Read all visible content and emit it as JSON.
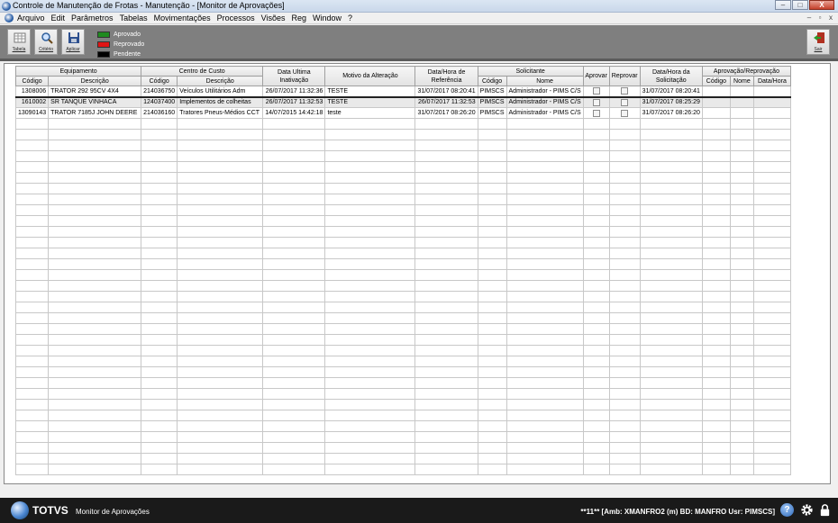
{
  "window": {
    "title": "Controle de Manutenção de Frotas - Manutenção - [Monitor de Aprovações]",
    "buttons": [
      "–",
      "□",
      "X"
    ]
  },
  "menubar": {
    "items": [
      "Arquivo",
      "Edit",
      "Parâmetros",
      "Tabelas",
      "Movimentações",
      "Processos",
      "Visões",
      "Reg",
      "Window",
      "?"
    ],
    "mdi_buttons": [
      "–",
      "▫",
      "x"
    ]
  },
  "toolbar": {
    "buttons": [
      {
        "label": "Tabela",
        "icon": "table-icon"
      },
      {
        "label": "Critério",
        "icon": "magnifier-icon"
      },
      {
        "label": "Aplicar",
        "icon": "floppy-disk-icon"
      }
    ],
    "exit_label": "Sair",
    "legend": [
      {
        "label": "Aprovado",
        "color": "#1f8a1f"
      },
      {
        "label": "Reprovado",
        "color": "#e01414"
      },
      {
        "label": "Pendente",
        "color": "#000000"
      }
    ]
  },
  "table": {
    "group_headers": {
      "equipamento": "Equipamento",
      "centro_custo": "Centro de Custo",
      "data_ultima": "Data Ultima Inativação",
      "motivo": "Motivo da Alteração",
      "data_referencia": "Data/Hora de Referência",
      "solicitante": "Solicitante",
      "aprovar": "Aprovar",
      "reprovar": "Reprovar",
      "data_solicitacao": "Data/Hora da Solicitação",
      "aprov_reprov": "Aprovação/Reprovação"
    },
    "sub_headers": {
      "eq_codigo": "Código",
      "eq_descricao": "Descrição",
      "cc_codigo": "Código",
      "cc_descricao": "Descrição",
      "sol_codigo": "Código",
      "sol_nome": "Nome",
      "ar_codigo": "Código",
      "ar_nome": "Nome",
      "ar_data": "Data/Hora"
    },
    "rows": [
      {
        "eq_codigo": "1308006",
        "eq_descricao": "TRATOR 292 95CV 4X4",
        "cc_codigo": "214036750",
        "cc_descricao": "Veículos Utilitários Adm",
        "data_ultima": "26/07/2017 11:32:36",
        "motivo": "TESTE",
        "data_referencia": "31/07/2017 08:20:41",
        "sol_codigo": "PIMSCS",
        "sol_nome": "Administrador - PIMS C/S",
        "aprovar": false,
        "reprovar": false,
        "data_solicitacao": "31/07/2017 08:20:41",
        "ar_codigo": "",
        "ar_nome": "",
        "ar_data": ""
      },
      {
        "eq_codigo": "1610002",
        "eq_descricao": "SR TANQUE VINHACA",
        "cc_codigo": "124037400",
        "cc_descricao": "Implementos de colheitas",
        "data_ultima": "26/07/2017 11:32:53",
        "motivo": "TESTE",
        "data_referencia": "26/07/2017 11:32:53",
        "sol_codigo": "PIMSCS",
        "sol_nome": "Administrador - PIMS C/S",
        "aprovar": false,
        "reprovar": false,
        "data_solicitacao": "31/07/2017 08:25:29",
        "ar_codigo": "",
        "ar_nome": "",
        "ar_data": ""
      },
      {
        "eq_codigo": "13090143",
        "eq_descricao": "TRATOR 7185J JOHN DEERE",
        "cc_codigo": "214036160",
        "cc_descricao": "Tratores Pneus-Médios CCT",
        "data_ultima": "14/07/2015 14:42:18",
        "motivo": "teste",
        "data_referencia": "31/07/2017 08:26:20",
        "sol_codigo": "PIMSCS",
        "sol_nome": "Administrador - PIMS C/S",
        "aprovar": false,
        "reprovar": false,
        "data_solicitacao": "31/07/2017 08:26:20",
        "ar_codigo": "",
        "ar_nome": "",
        "ar_data": ""
      }
    ]
  },
  "statusbar": {
    "logo": "TOTVS",
    "screen_name": "Monitor de Aprovações",
    "env_info": "**11**   [Amb: XMANFRO2  (m) BD: MANFRO Usr: PIMSCS]",
    "help": "?"
  }
}
